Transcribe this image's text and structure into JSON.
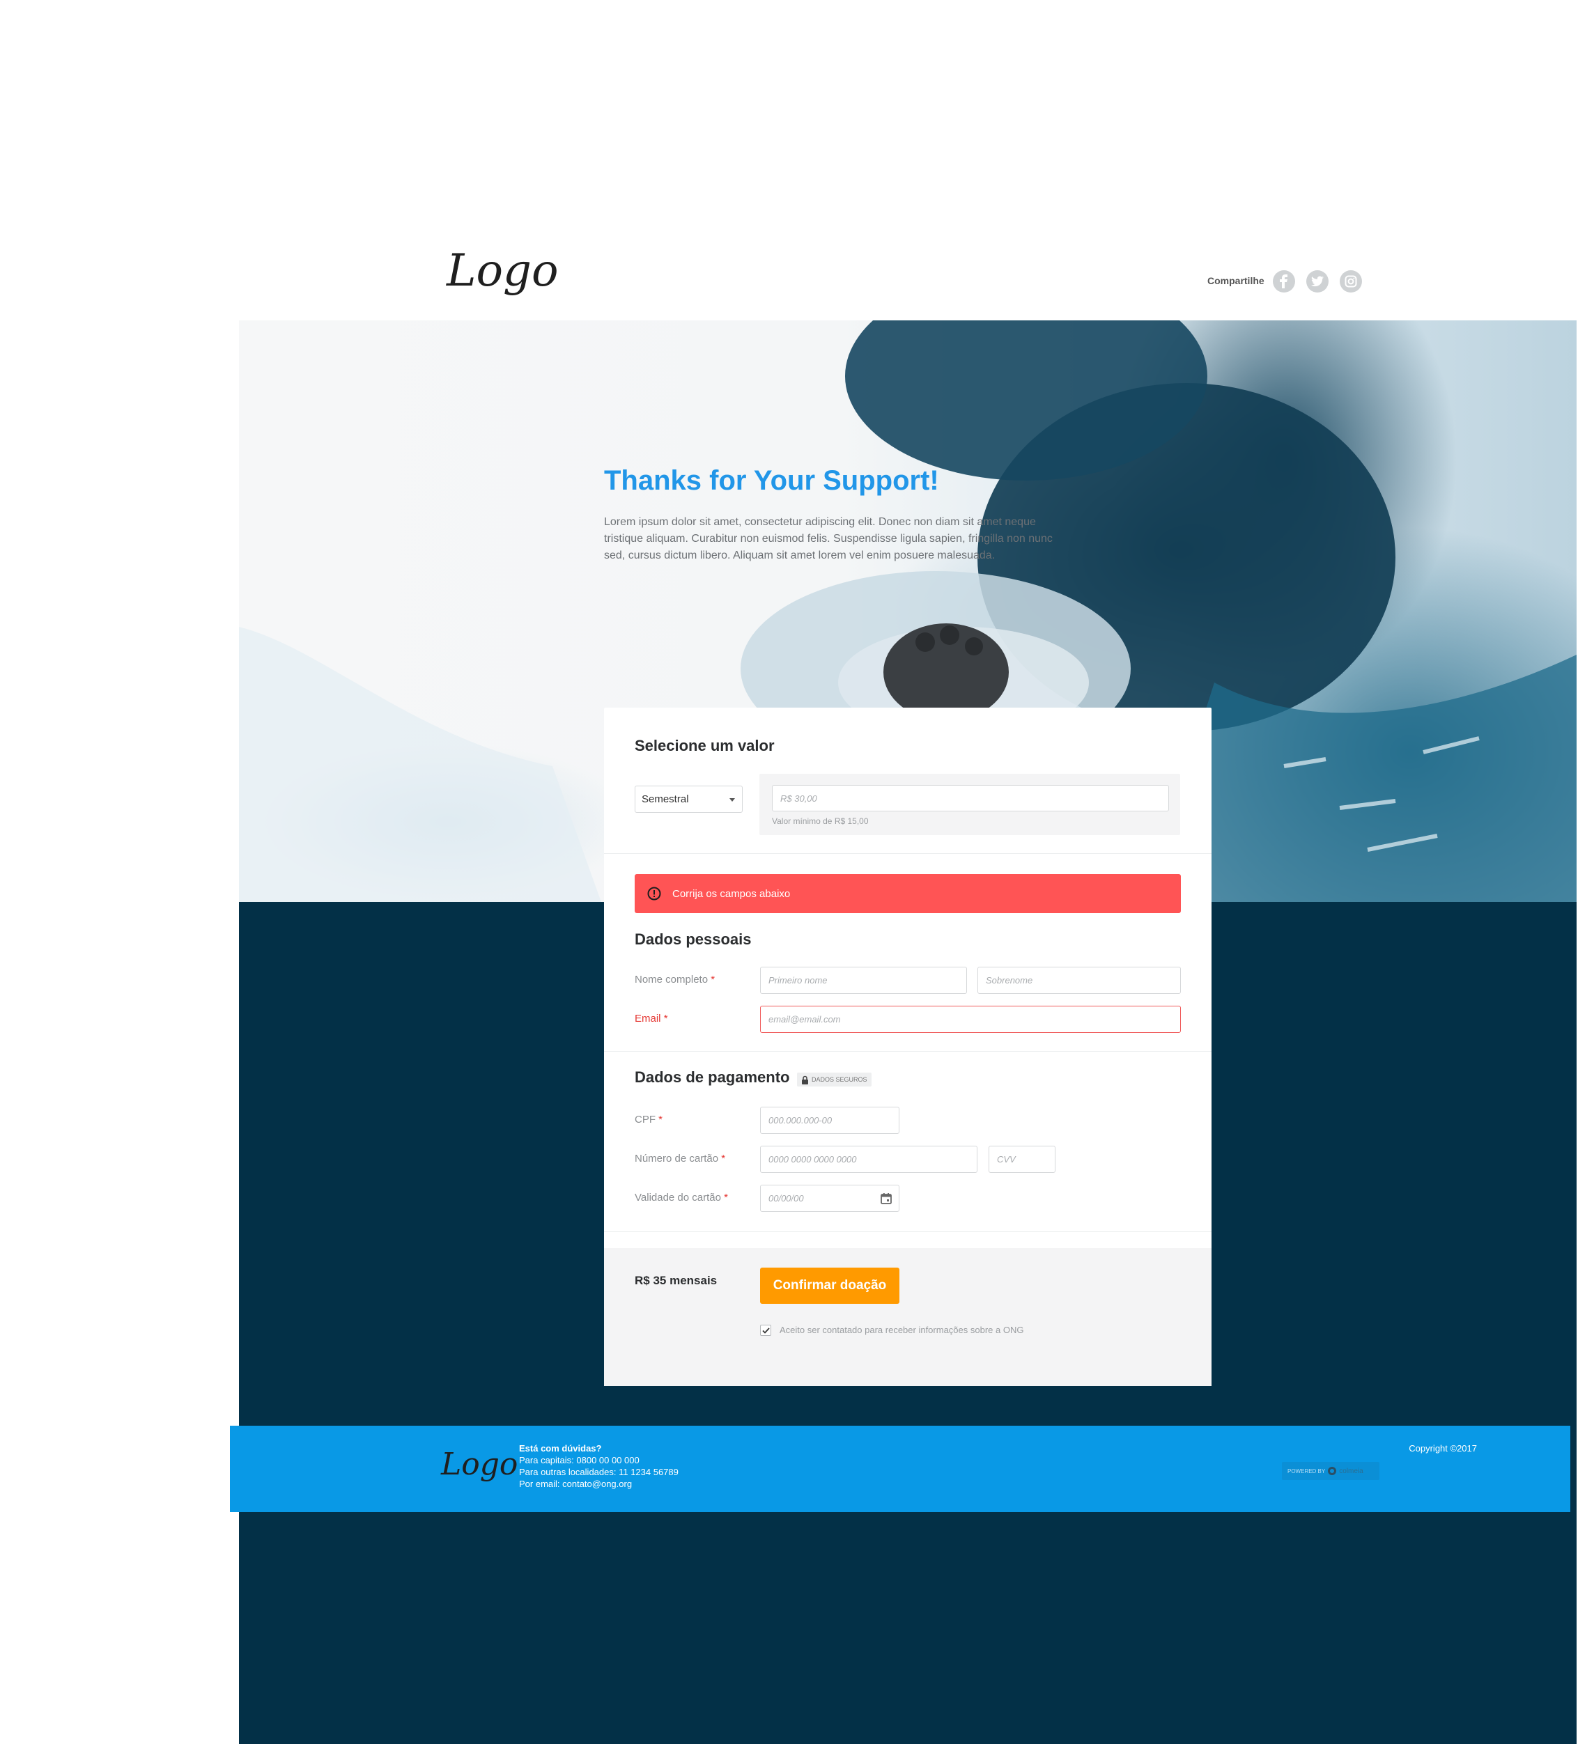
{
  "header": {
    "logo": "Logo",
    "share_label": "Compartilhe",
    "social": [
      "facebook-icon",
      "twitter-icon",
      "instagram-icon"
    ]
  },
  "hero": {
    "title": "Thanks for Your Support!",
    "text": "Lorem ipsum dolor sit amet, consectetur adipiscing elit. Donec non diam sit amet neque tristique aliquam. Curabitur non euismod felis. Suspendisse ligula sapien, fringilla non nunc sed, cursus dictum libero. Aliquam sit amet lorem vel enim posuere malesuada."
  },
  "amount": {
    "title": "Selecione um valor",
    "frequency": "Semestral",
    "value_placeholder": "R$ 30,00",
    "hint": "Valor mínimo de R$ 15,00"
  },
  "alert": {
    "text": "Corrija os campos abaixo"
  },
  "personal": {
    "title": "Dados pessoais",
    "name_label": "Nome completo",
    "first_placeholder": "Primeiro nome",
    "last_placeholder": "Sobrenome",
    "email_label": "Email",
    "email_placeholder": "email@email.com"
  },
  "payment": {
    "title": "Dados de pagamento",
    "secure_badge": "DADOS SEGUROS",
    "cpf_label": "CPF",
    "cpf_placeholder": "000.000.000-00",
    "card_label": "Número de cartão",
    "card_placeholder": "0000 0000 0000 0000",
    "cvv_placeholder": "CVV",
    "expiry_label": "Validade do cartão",
    "expiry_placeholder": "00/00/00"
  },
  "summary": {
    "total": "R$ 35 mensais",
    "confirm": "Confirmar doação",
    "consent": "Aceito ser contatado para receber informações sobre a ONG",
    "consent_checked": true
  },
  "required_mark": "*",
  "footer": {
    "logo": "Logo",
    "question": "Está com dúvidas?",
    "line1": "Para  capitais: 0800 00 00 000",
    "line2": "Para  outras localidades: 11 1234 56789",
    "line3": "Por email: contato@ong.org",
    "copyright": "Copyright ©2017",
    "powered_by": "POWERED BY",
    "powered_brand": "colmeia"
  },
  "colors": {
    "accent": "#2196e8",
    "error": "#ff5455",
    "cta": "#ff9a00",
    "footer": "#0999e6",
    "dark_bg": "#033047"
  }
}
